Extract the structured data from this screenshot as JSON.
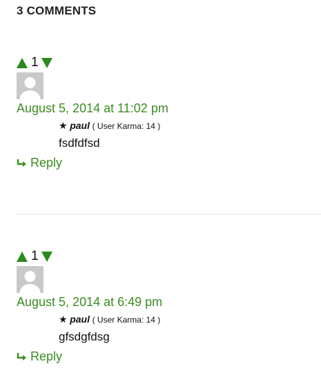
{
  "heading": "3 COMMENTS",
  "colors": {
    "accent": "#3c8d22",
    "arrow": "#2b8a1e"
  },
  "comments": [
    {
      "score": "1",
      "date": "August 5, 2014 at 11:02 pm",
      "star": "★",
      "author": "paul",
      "karma": "( User Karma: 14 )",
      "text": "fsdfdfsd",
      "reply": "Reply"
    },
    {
      "score": "1",
      "date": "August 5, 2014 at 6:49 pm",
      "star": "★",
      "author": "paul",
      "karma": "( User Karma: 14 )",
      "text": "gfsdgfdsg",
      "reply": "Reply"
    }
  ]
}
